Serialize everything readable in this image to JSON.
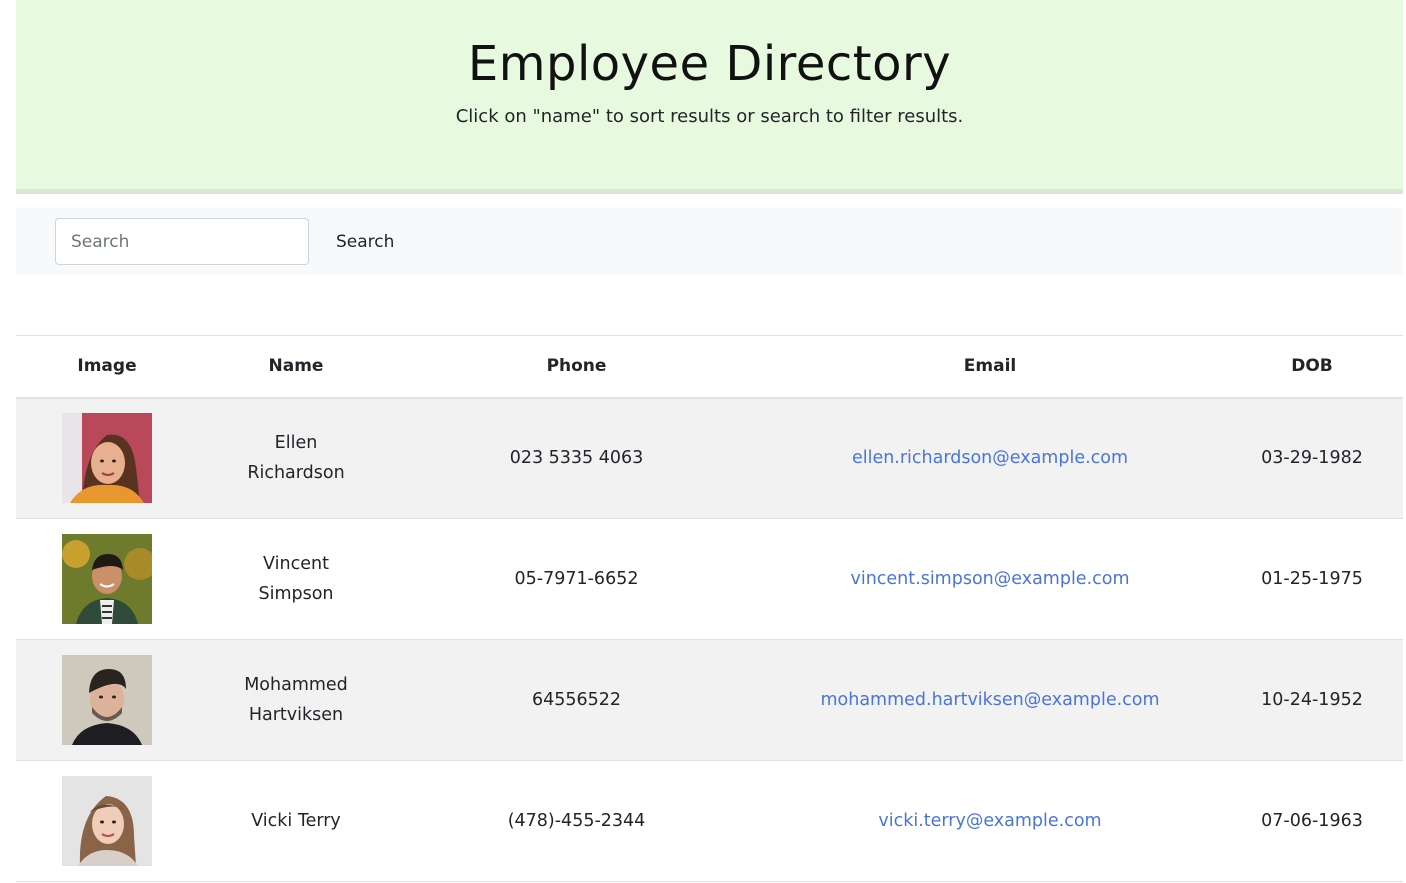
{
  "header": {
    "title": "Employee Directory",
    "subtitle": "Click on \"name\" to sort results or search to filter results."
  },
  "search": {
    "placeholder": "Search",
    "value": "",
    "button_label": "Search"
  },
  "table": {
    "columns": [
      "Image",
      "Name",
      "Phone",
      "Email",
      "DOB"
    ],
    "rows": [
      {
        "name": "Ellen Richardson",
        "phone": "023 5335 4063",
        "email": "ellen.richardson@example.com",
        "dob": "03-29-1982",
        "avatar_icon": "woman-portrait-icon"
      },
      {
        "name": "Vincent Simpson",
        "phone": "05-7971-6652",
        "email": "vincent.simpson@example.com",
        "dob": "01-25-1975",
        "avatar_icon": "man-portrait-icon"
      },
      {
        "name": "Mohammed Hartviksen",
        "phone": "64556522",
        "email": "mohammed.hartviksen@example.com",
        "dob": "10-24-1952",
        "avatar_icon": "man-portrait-icon"
      },
      {
        "name": "Vicki Terry",
        "phone": "(478)-455-2344",
        "email": "vicki.terry@example.com",
        "dob": "07-06-1963",
        "avatar_icon": "woman-portrait-icon"
      }
    ]
  },
  "colors": {
    "hero_bg": "#e7fadf",
    "link": "#4a74dd",
    "stripe": "#f2f2f2"
  }
}
